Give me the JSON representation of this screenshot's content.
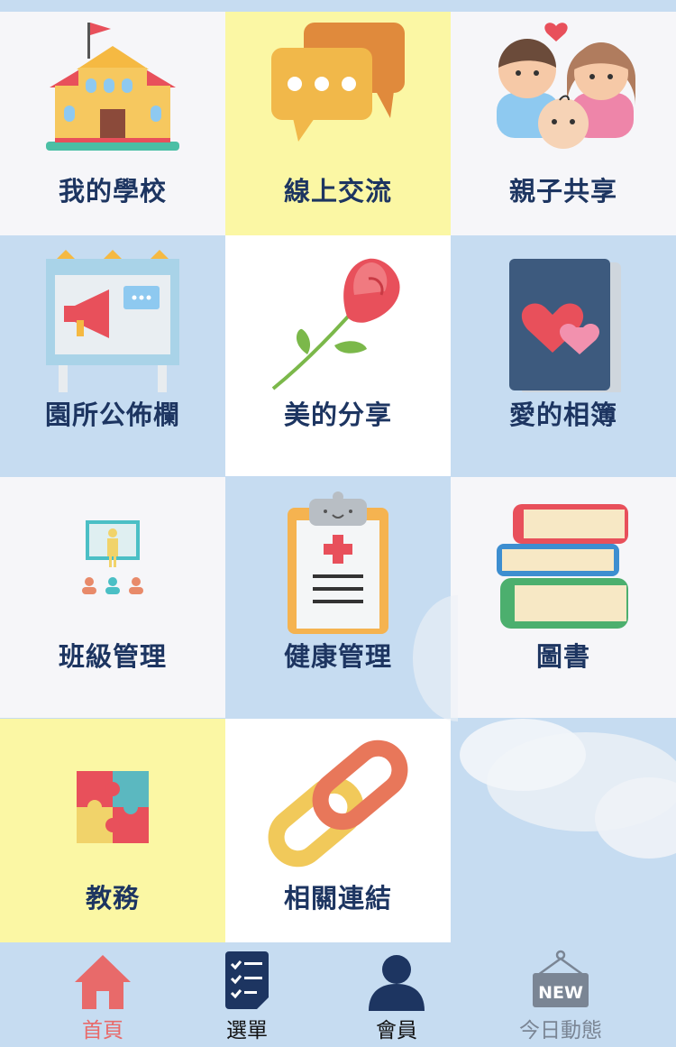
{
  "grid": {
    "tiles": [
      {
        "label": "我的學校",
        "icon": "school-icon"
      },
      {
        "label": "線上交流",
        "icon": "chat-bubbles-icon"
      },
      {
        "label": "親子共享",
        "icon": "family-icon"
      },
      {
        "label": "園所公佈欄",
        "icon": "bulletin-board-icon"
      },
      {
        "label": "美的分享",
        "icon": "rose-icon"
      },
      {
        "label": "愛的相簿",
        "icon": "heart-album-icon"
      },
      {
        "label": "班級管理",
        "icon": "classroom-icon"
      },
      {
        "label": "健康管理",
        "icon": "health-clipboard-icon"
      },
      {
        "label": "圖書",
        "icon": "books-icon"
      },
      {
        "label": "教務",
        "icon": "puzzle-icon"
      },
      {
        "label": "相關連結",
        "icon": "chain-link-icon"
      }
    ]
  },
  "tabbar": {
    "home": "首頁",
    "menu": "選單",
    "member": "會員",
    "news": "今日動態",
    "news_badge": "NEW"
  },
  "colors": {
    "label_text": "#1d3561",
    "active_tab": "#e86a6a",
    "inactive_tab": "#7a8594",
    "tile_blue": "#c6dcf1",
    "tile_yellow": "#fbf7a4",
    "tile_white": "#f6f6f9"
  }
}
